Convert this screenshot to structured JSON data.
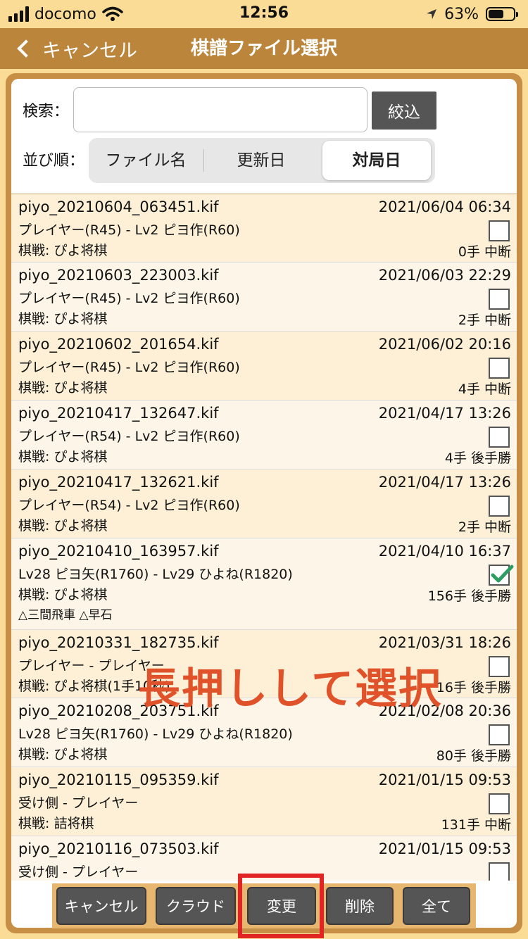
{
  "status_bar": {
    "carrier": "docomo",
    "time": "12:56",
    "battery": "63%",
    "battery_level": 0.63
  },
  "nav": {
    "back_label": "キャンセル",
    "title": "棋譜ファイル選択"
  },
  "search": {
    "label": "検索：",
    "value": "",
    "filter_button": "絞込"
  },
  "sort": {
    "label": "並び順：",
    "options": [
      "ファイル名",
      "更新日",
      "対局日"
    ],
    "selected": "対局日"
  },
  "files": [
    {
      "filename": "piyo_20210604_063451.kif",
      "date": "2021/06/04 06:34",
      "players": "プレイヤー(R45) - Lv2 ピヨ作(R60)",
      "game": "棋戦: ぴよ将棋",
      "result": "0手 中断",
      "checked": false
    },
    {
      "filename": "piyo_20210603_223003.kif",
      "date": "2021/06/03 22:29",
      "players": "プレイヤー(R45) - Lv2 ピヨ作(R60)",
      "game": "棋戦: ぴよ将棋",
      "result": "2手 中断",
      "checked": false
    },
    {
      "filename": "piyo_20210602_201654.kif",
      "date": "2021/06/02 20:16",
      "players": "プレイヤー(R45) - Lv2 ピヨ作(R60)",
      "game": "棋戦: ぴよ将棋",
      "result": "4手 中断",
      "checked": false
    },
    {
      "filename": "piyo_20210417_132647.kif",
      "date": "2021/04/17 13:26",
      "players": "プレイヤー(R54) - Lv2 ピヨ作(R60)",
      "game": "棋戦: ぴよ将棋",
      "result": "4手 後手勝",
      "checked": false
    },
    {
      "filename": "piyo_20210417_132621.kif",
      "date": "2021/04/17 13:26",
      "players": "プレイヤー(R54) - Lv2 ピヨ作(R60)",
      "game": "棋戦: ぴよ将棋",
      "result": "2手 中断",
      "checked": false
    },
    {
      "filename": "piyo_20210410_163957.kif",
      "date": "2021/04/10 16:37",
      "players": "Lv28 ピヨ矢(R1760) - Lv29 ひよね(R1820)",
      "game": "棋戦: ぴよ将棋",
      "extra": "△三間飛車 △早石",
      "result": "156手 後手勝",
      "checked": true
    },
    {
      "filename": "piyo_20210331_182735.kif",
      "date": "2021/03/31 18:26",
      "players": "プレイヤー - プレイヤー",
      "game": "棋戦: ぴよ将棋(1手10秒)",
      "result": "16手 後手勝",
      "checked": false
    },
    {
      "filename": "piyo_20210208_203751.kif",
      "date": "2021/02/08 20:36",
      "players": "Lv28 ピヨ矢(R1760) - Lv29 ひよね(R1820)",
      "game": "棋戦: ぴよ将棋",
      "result": "80手 後手勝",
      "checked": false
    },
    {
      "filename": "piyo_20210115_095359.kif",
      "date": "2021/01/15 09:53",
      "players": "受け側 - プレイヤー",
      "game": "棋戦: 詰将棋",
      "result": "131手 中断",
      "checked": false
    },
    {
      "filename": "piyo_20210116_073503.kif",
      "date": "2021/01/15 09:53",
      "players": "受け側 - プレイヤー",
      "game": "",
      "result": "",
      "checked": false
    }
  ],
  "overlay_caption": "長押しして選択",
  "toolbar": {
    "buttons": [
      "キャンセル",
      "クラウド",
      "変更",
      "削除",
      "全て"
    ]
  }
}
